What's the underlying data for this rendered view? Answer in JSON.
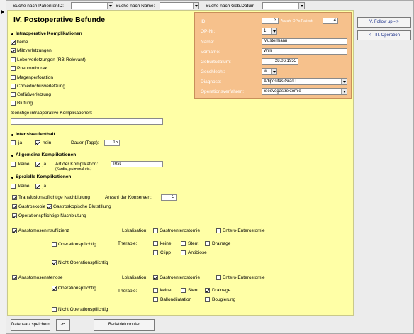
{
  "top": {
    "search_patient_label": "Suche nach PatientenID:",
    "search_name_label": "Suche nach Name:",
    "search_dob_label": "Suche nach Geb.Datum"
  },
  "title": "IV. Postoperative Befunde",
  "intraop": {
    "heading": "Intraoperative Komplikationen",
    "items": [
      {
        "label": "keine",
        "checked": true
      },
      {
        "label": "Milzverletzungen",
        "checked": true
      },
      {
        "label": "Leberverletzungen (RB-Relevant)",
        "checked": false
      },
      {
        "label": "Pneumothorax",
        "checked": false
      },
      {
        "label": "Magenperforation",
        "checked": false
      },
      {
        "label": "Choledochusverletzung",
        "checked": false
      },
      {
        "label": "Gefäßverletzung",
        "checked": false
      },
      {
        "label": "Blutung",
        "checked": false
      }
    ],
    "sonstige_label": "Sonstige intraoperative Komplikationen:",
    "sonstige_value": ""
  },
  "intensiv": {
    "heading": "Intensivaufenthalt",
    "ja_label": "ja",
    "ja_checked": false,
    "nein_label": "nein",
    "nein_checked": true,
    "dauer_label": "Dauer (Tage):",
    "dauer_value": "15"
  },
  "allgemein": {
    "heading": "Allgemeine Komplikationen",
    "keine_label": "keine",
    "keine_checked": false,
    "ja_label": "ja",
    "ja_checked": true,
    "art_label": "Art der Komplikation:",
    "art_sublabel": "(Kardial, pulmonal etc.)",
    "art_value": "Test"
  },
  "speziell": {
    "heading": "Spezielle Komplikationen:",
    "keine_label": "keine",
    "keine_checked": false,
    "ja_label": "ja",
    "ja_checked": true,
    "transfusion_label": "Transfusionspflichtige Nachblutung",
    "transfusion_checked": true,
    "konserven_label": "Anzahl der Konserven:",
    "konserven_value": "5",
    "gastroskopie_label": "Gastroskopie",
    "gastroskopie_checked": true,
    "gastro_blut_label": "Gastroskopische Blutstillung",
    "gastro_blut_checked": true,
    "op_nachblutung_label": "Operationspflichtige Nachblutung",
    "op_nachblutung_checked": true
  },
  "insuff": {
    "label": "Anastomoseninsuffizienz",
    "checked": true,
    "oppflichtig_label": "Operationspflichtig",
    "oppflichtig_checked": false,
    "nicht_label": "Nicht Operationspflichtig",
    "nicht_checked": true,
    "lokalisation_label": "Lokalisation:",
    "gastroentero_label": "Gastroenterostomie",
    "gastroentero_checked": false,
    "enteroentero_label": "Entero-Enterostomie",
    "enteroentero_checked": false,
    "therapie_label": "Therapie:",
    "keine_label": "keine",
    "keine_checked": false,
    "stent_label": "Stent",
    "stent_checked": false,
    "drainage_label": "Drainage",
    "drainage_checked": false,
    "clipp_label": "Clipp",
    "clipp_checked": false,
    "antibiose_label": "Antibiose",
    "antibiose_checked": false
  },
  "stenose": {
    "label": "Anastomosenstenose",
    "checked": true,
    "oppflichtig_label": "Operationspflichtig",
    "oppflichtig_checked": true,
    "nicht_label": "Nicht Operationspflichtig",
    "nicht_checked": false,
    "lokalisation_label": "Lokalisation:",
    "gastroentero_label": "Gastroenterostomie",
    "gastroentero_checked": true,
    "enteroentero_label": "Entero-Enterostomie",
    "enteroentero_checked": false,
    "therapie_label": "Therapie:",
    "keine_label": "keine",
    "keine_checked": false,
    "stent_label": "Stent",
    "stent_checked": false,
    "drainage_label": "Drainage",
    "drainage_checked": true,
    "ballon_label": "Ballondilatation",
    "ballon_checked": false,
    "bougierung_label": "Bougierung",
    "bougierung_checked": false
  },
  "patient": {
    "id_label": "ID:",
    "id_value": "3",
    "anzahl_label": "Anzahl OP's Patient:",
    "anzahl_value": "4",
    "opnr_label": "OP-Nr:",
    "opnr_value": "1",
    "name_label": "Name:",
    "name_value": "Mustermann",
    "vorname_label": "Vorname:",
    "vorname_value": "Willi",
    "geb_label": "Geburtsdatum:",
    "geb_value": "28.06.1955",
    "geschlecht_label": "Geschlecht:",
    "geschlecht_value": "w",
    "diagnose_label": "Diagnose:",
    "diagnose_value": "Adipositas Grad I",
    "verfahren_label": "Operationsverfahren:",
    "verfahren_value": "Sleevegastrektomie"
  },
  "nav": {
    "follow_up_label": "V. Follow up -->",
    "operation_label": "<-- III. Operation"
  },
  "bottom": {
    "save_label": "Datensatz speichern",
    "undo_label": "↶",
    "report_label": "Bariatrieformular"
  }
}
